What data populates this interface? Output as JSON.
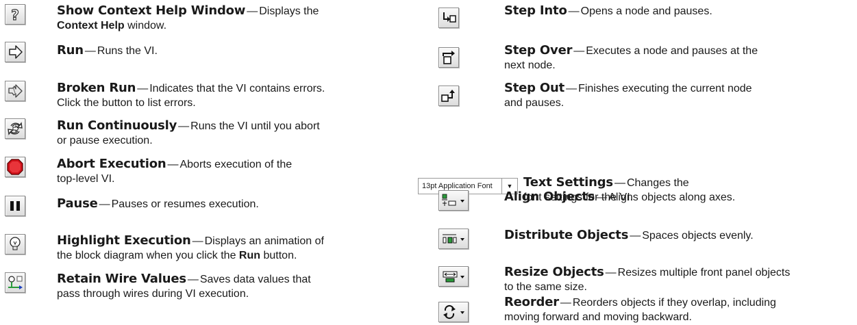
{
  "left": [
    {
      "name": "Show Context Help Window",
      "icon": "question-mark-icon",
      "line1": "Displays the",
      "bold2": "Context Help",
      "line2": " window."
    },
    {
      "name": "Run",
      "icon": "run-arrow-icon",
      "line1": "Runs the VI."
    },
    {
      "name": "Broken Run",
      "icon": "broken-run-arrow-icon",
      "line1": "Indicates that the VI contains errors.",
      "line2": "Click the button to list errors."
    },
    {
      "name": "Run Continuously",
      "icon": "run-continuously-icon",
      "line1": "Runs the VI until you abort",
      "line2": "or pause execution."
    },
    {
      "name": "Abort Execution",
      "icon": "abort-stop-icon",
      "line1": "Aborts execution of the",
      "line2": "top-level VI."
    },
    {
      "name": "Pause",
      "icon": "pause-icon",
      "line1": "Pauses or resumes execution."
    },
    {
      "name": "Highlight Execution",
      "icon": "light-bulb-icon",
      "line1": "Displays an animation of",
      "line2a": "the block diagram when you click the ",
      "bold2": "Run",
      "line2b": " button."
    },
    {
      "name": "Retain Wire Values",
      "icon": "retain-wire-values-icon",
      "line1": "Saves data values that",
      "line2": "pass through wires during VI execution."
    }
  ],
  "right": [
    {
      "name": "Step Into",
      "icon": "step-into-icon",
      "line1": "Opens a node and pauses."
    },
    {
      "name": "Step Over",
      "icon": "step-over-icon",
      "line1": "Executes a node and pauses at the",
      "line2": "next node."
    },
    {
      "name": "Step Out",
      "icon": "step-out-icon",
      "line1": "Finishes executing the current node",
      "line2": "and pauses."
    },
    {
      "name": "Text Settings",
      "icon": "font-ring",
      "ring_text": "13pt Application Font",
      "line1": "Changes the",
      "line2": "font settings for the VI."
    },
    {
      "name": "Align Objects",
      "icon": "align-objects-icon",
      "line1": "Aligns objects along axes."
    },
    {
      "name": "Distribute Objects",
      "icon": "distribute-objects-icon",
      "line1": "Spaces objects evenly."
    },
    {
      "name": "Resize Objects",
      "icon": "resize-objects-icon",
      "line1": "Resizes multiple front panel objects",
      "line2": "to the same size."
    },
    {
      "name": "Reorder",
      "icon": "reorder-icon",
      "line1": "Reorders objects if they overlap, including",
      "line2": "moving forward and moving backward."
    }
  ],
  "separator": "—",
  "colors": {
    "stop_red": "#d0121b",
    "wire_green": "#2a9a3a",
    "blue": "#1a3fbf",
    "gray_text": "#1a1a1a"
  }
}
